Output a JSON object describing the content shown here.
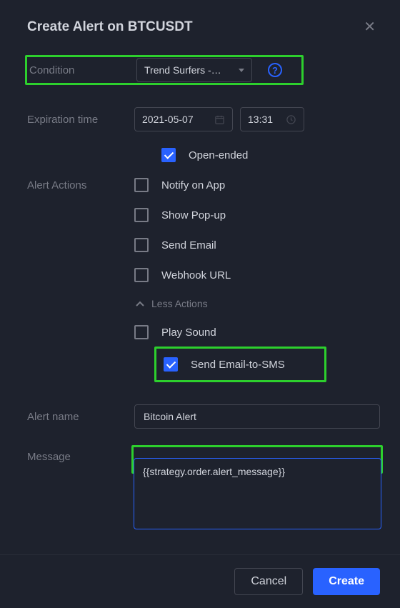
{
  "header": {
    "title": "Create Alert on BTCUSDT"
  },
  "labels": {
    "condition": "Condition",
    "expiration": "Expiration time",
    "alert_actions": "Alert Actions",
    "less_actions": "Less Actions",
    "alert_name": "Alert name",
    "message": "Message"
  },
  "condition": {
    "selected": "Trend Surfers -…"
  },
  "expiration": {
    "date": "2021-05-07",
    "time": "13:31"
  },
  "open_ended": {
    "label": "Open-ended",
    "checked": true
  },
  "actions": {
    "notify_app": {
      "label": "Notify on App",
      "checked": false
    },
    "show_popup": {
      "label": "Show Pop-up",
      "checked": false
    },
    "send_email": {
      "label": "Send Email",
      "checked": false
    },
    "webhook": {
      "label": "Webhook URL",
      "checked": false
    },
    "play_sound": {
      "label": "Play Sound",
      "checked": false
    },
    "send_sms": {
      "label": "Send Email-to-SMS",
      "checked": true
    }
  },
  "alert_name": {
    "value": "Bitcoin Alert"
  },
  "message": {
    "value": "{{strategy.order.alert_message}}"
  },
  "footer": {
    "cancel": "Cancel",
    "create": "Create"
  }
}
